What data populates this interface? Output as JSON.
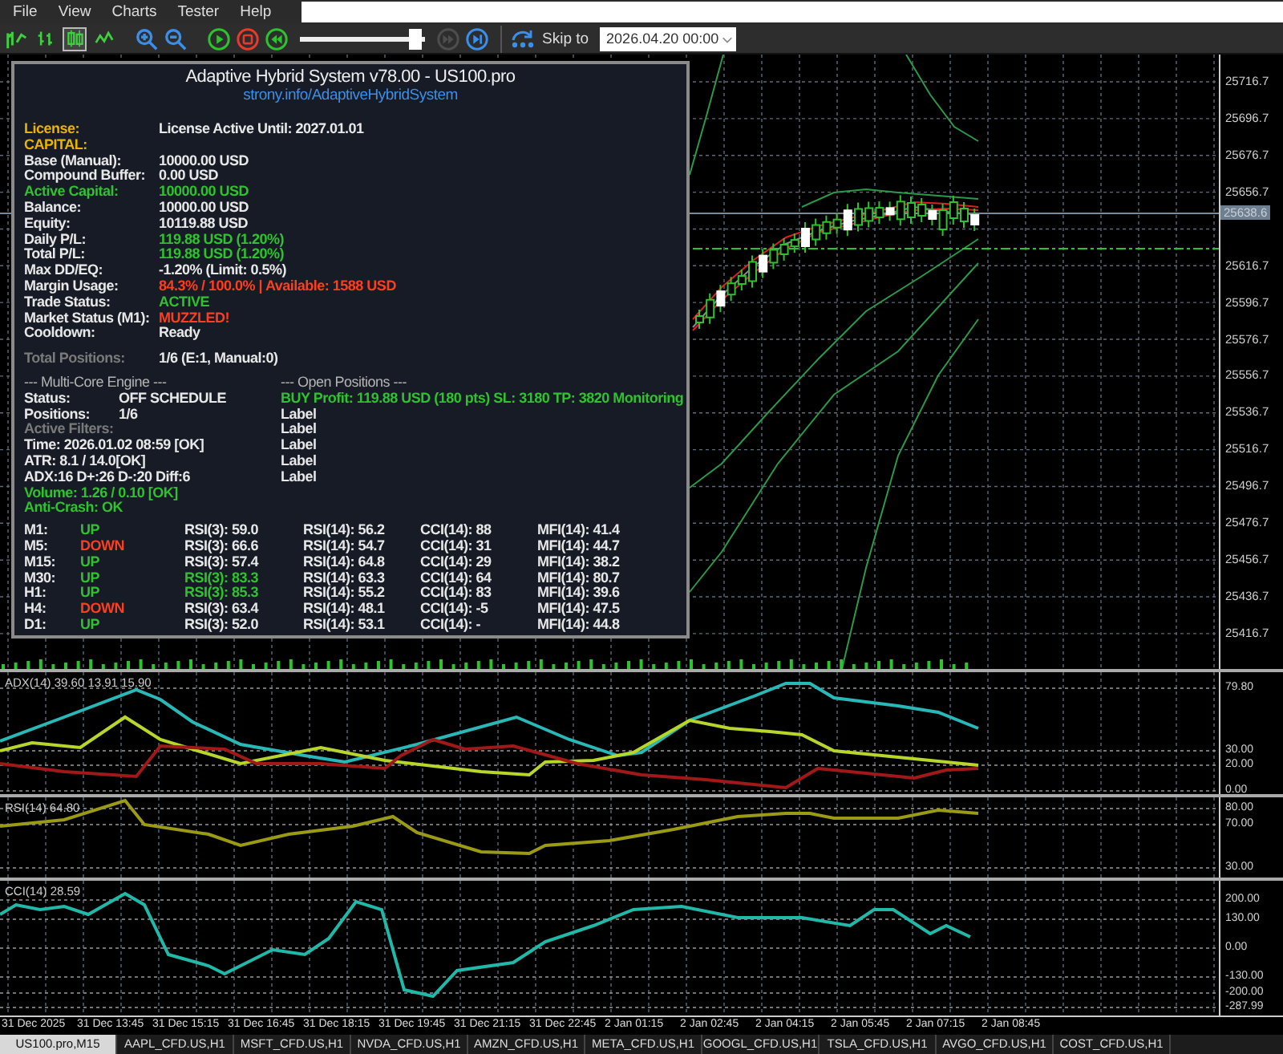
{
  "menu": [
    "File",
    "View",
    "Charts",
    "Tester",
    "Help"
  ],
  "toolbar": {
    "chart_modes": [
      {
        "kind": "bars",
        "selected": false
      },
      {
        "kind": "candles",
        "selected": true
      },
      {
        "kind": "line",
        "selected": false
      }
    ],
    "slider": {
      "level": 0.97
    },
    "step_button": {
      "disabled": true
    },
    "skip_label": "Skip to",
    "date_field": "2026.04.20 00:00"
  },
  "price_axis": {
    "ticks": [
      "25716.7",
      "25696.7",
      "25676.7",
      "25656.7",
      "25616.7",
      "25596.7",
      "25576.7",
      "25556.7",
      "25536.7",
      "25516.7",
      "25496.7",
      "25476.7",
      "25456.7",
      "25436.7",
      "25416.7"
    ],
    "current_price": "25638.6"
  },
  "panel": {
    "title": "Adaptive Hybrid System v78.00 - US100.pro",
    "link": "strony.info/AdaptiveHybridSystem",
    "rows": [
      {
        "label": "License:",
        "color": "#e8b400",
        "value": {
          "text": "License Active Until: 2027.01.01",
          "color": "#e8e8e8"
        }
      },
      {
        "label": "CAPITAL:",
        "color": "#e8b400"
      },
      {
        "label": "Base (Manual):",
        "color": "#e8e8e8",
        "value": {
          "text": "10000.00 USD",
          "color": "#e8e8e8"
        }
      },
      {
        "label": "Compound Buffer:",
        "color": "#e8e8e8",
        "value": {
          "text": "0.00 USD",
          "color": "#e8e8e8"
        }
      },
      {
        "label": "Active Capital:",
        "color": "#2ec22e",
        "value": {
          "text": "10000.00 USD",
          "color": "#2ec22e"
        }
      },
      {
        "label": "Balance:",
        "color": "#e8e8e8",
        "value": {
          "text": "10000.00 USD",
          "color": "#e8e8e8"
        }
      },
      {
        "label": "Equity:",
        "color": "#e8e8e8",
        "value": {
          "text": "10119.88 USD",
          "color": "#e8e8e8"
        }
      },
      {
        "label": "Daily P/L:",
        "color": "#e8e8e8",
        "value": {
          "text": "119.88 USD (1.20%)",
          "color": "#2ec22e"
        }
      },
      {
        "label": "Total P/L:",
        "color": "#e8e8e8",
        "value": {
          "text": "119.88 USD (1.20%)",
          "color": "#2ec22e"
        }
      },
      {
        "label": "Max DD/EQ:",
        "color": "#e8e8e8",
        "value": {
          "text": "-1.20% (Limit: 0.5%)",
          "color": "#e8e8e8"
        }
      },
      {
        "label": "Margin Usage:",
        "color": "#e8e8e8",
        "value": {
          "text": "84.3% / 100.0% | Available: 1588 USD",
          "color": "#ff3d1f"
        }
      },
      {
        "label": "Trade Status:",
        "color": "#e8e8e8",
        "value": {
          "text": "ACTIVE",
          "color": "#2ec22e"
        }
      },
      {
        "label": "Market Status (M1):",
        "color": "#e8e8e8",
        "value": {
          "text": "MUZZLED!",
          "color": "#ff3d1f"
        }
      },
      {
        "label": "Cooldown:",
        "color": "#e8e8e8",
        "value": {
          "text": "Ready",
          "color": "#e8e8e8"
        }
      }
    ],
    "total": {
      "label": "Total Positions:",
      "value": "1/6 (E:1, Manual:0)"
    },
    "engine": {
      "header": "--- Multi-Core Engine ---",
      "status_label": "Status:",
      "status": "OFF SCHEDULE",
      "positions_label": "Positions:",
      "positions": "1/6",
      "filters_header": "Active Filters:",
      "filters": [
        {
          "text": "Time: 2026.01.02 08:59 [OK]",
          "color": "#e8e8e8"
        },
        {
          "text": "ATR: 8.1 / 14.0[OK]",
          "color": "#e8e8e8"
        },
        {
          "text": "ADX:16 D+:26 D-:20 Diff:6",
          "color": "#e8e8e8"
        },
        {
          "text": "Volume: 1.26 / 0.10 [OK]",
          "color": "#2ec22e"
        },
        {
          "text": "Anti-Crash: OK",
          "color": "#2ec22e"
        }
      ]
    },
    "open_positions": {
      "header": "--- Open Positions ---",
      "lines": [
        {
          "text": "BUY Profit: 119.88 USD (180 pts) SL: 3180 TP: 3820 Monitoring",
          "color": "#2ec22e"
        },
        {
          "text": "Label",
          "color": "#e8e8e8"
        },
        {
          "text": "Label",
          "color": "#e8e8e8"
        },
        {
          "text": "Label",
          "color": "#e8e8e8"
        },
        {
          "text": "Label",
          "color": "#e8e8e8"
        },
        {
          "text": "Label",
          "color": "#e8e8e8"
        }
      ]
    },
    "timeframes": [
      {
        "tf": "M1:",
        "trend": {
          "text": "UP",
          "color": "#2ec22e"
        },
        "rsi3": {
          "text": "RSI(3): 59.0",
          "color": "#e8e8e8"
        },
        "rsi14": "RSI(14): 56.2",
        "cci": "CCI(14): 88",
        "mfi": "MFI(14): 41.4"
      },
      {
        "tf": "M5:",
        "trend": {
          "text": "DOWN",
          "color": "#ff3d1f"
        },
        "rsi3": {
          "text": "RSI(3): 66.6",
          "color": "#e8e8e8"
        },
        "rsi14": "RSI(14): 54.7",
        "cci": "CCI(14): 31",
        "mfi": "MFI(14): 44.7"
      },
      {
        "tf": "M15:",
        "trend": {
          "text": "UP",
          "color": "#2ec22e"
        },
        "rsi3": {
          "text": "RSI(3): 57.4",
          "color": "#e8e8e8"
        },
        "rsi14": "RSI(14): 64.8",
        "cci": "CCI(14): 29",
        "mfi": "MFI(14): 38.2"
      },
      {
        "tf": "M30:",
        "trend": {
          "text": "UP",
          "color": "#2ec22e"
        },
        "rsi3": {
          "text": "RSI(3): 83.3",
          "color": "#2ec22e"
        },
        "rsi14": "RSI(14): 63.3",
        "cci": "CCI(14): 64",
        "mfi": "MFI(14): 80.7"
      },
      {
        "tf": "H1:",
        "trend": {
          "text": "UP",
          "color": "#2ec22e"
        },
        "rsi3": {
          "text": "RSI(3): 85.3",
          "color": "#2ec22e"
        },
        "rsi14": "RSI(14): 55.2",
        "cci": "CCI(14): 83",
        "mfi": "MFI(14): 39.6"
      },
      {
        "tf": "H4:",
        "trend": {
          "text": "DOWN",
          "color": "#ff3d1f"
        },
        "rsi3": {
          "text": "RSI(3): 63.4",
          "color": "#e8e8e8"
        },
        "rsi14": "RSI(14): 48.1",
        "cci": "CCI(14): -5",
        "mfi": "MFI(14): 47.5"
      },
      {
        "tf": "D1:",
        "trend": {
          "text": "UP",
          "color": "#2ec22e"
        },
        "rsi3": {
          "text": "RSI(3): 52.0",
          "color": "#e8e8e8"
        },
        "rsi14": "RSI(14): 53.1",
        "cci": "CCI(14): -",
        "mfi": "MFI(14): 44.8"
      }
    ]
  },
  "indicators": [
    {
      "kind": "adx",
      "legend": "ADX(14) 39.60 13.91 15.90",
      "ticks": [
        "79.80",
        "30.00",
        "20.00",
        "0.00"
      ]
    },
    {
      "kind": "rsi",
      "legend": "RSI(14) 64.80",
      "ticks": [
        "80.00",
        "70.00",
        "30.00"
      ]
    },
    {
      "kind": "cci",
      "legend": "CCI(14) 28.59",
      "ticks": [
        "200.00",
        "130.00",
        "0.00",
        "-130.00",
        "-200.00",
        "-287.99"
      ]
    }
  ],
  "time_axis": [
    "31 Dec 2025",
    "31 Dec 13:45",
    "31 Dec 15:15",
    "31 Dec 16:45",
    "31 Dec 18:15",
    "31 Dec 19:45",
    "31 Dec 21:15",
    "31 Dec 22:45",
    "2 Jan 01:15",
    "2 Jan 02:45",
    "2 Jan 04:15",
    "2 Jan 05:45",
    "2 Jan 07:15",
    "2 Jan 08:45"
  ],
  "symbol_tabs": [
    {
      "label": "US100.pro,M15",
      "selected": true
    },
    {
      "label": "AAPL_CFD.US,H1",
      "selected": false
    },
    {
      "label": "MSFT_CFD.US,H1",
      "selected": false
    },
    {
      "label": "NVDA_CFD.US,H1",
      "selected": false
    },
    {
      "label": "AMZN_CFD.US,H1",
      "selected": false
    },
    {
      "label": "META_CFD.US,H1",
      "selected": false
    },
    {
      "label": "GOOGL_CFD.US,H1",
      "selected": false
    },
    {
      "label": "TSLA_CFD.US,H1",
      "selected": false
    },
    {
      "label": "AVGO_CFD.US,H1",
      "selected": false
    },
    {
      "label": "COST_CFD.US,H1",
      "selected": false
    }
  ]
}
